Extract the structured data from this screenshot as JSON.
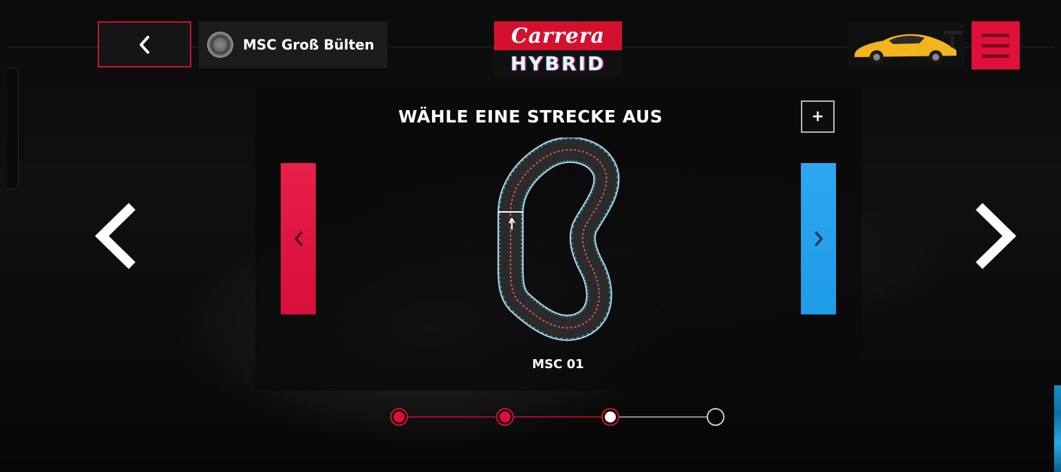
{
  "header": {
    "club_name": "MSC Groß Bülten",
    "logo_top": "Carrera",
    "logo_bottom": "HYBRID"
  },
  "panel": {
    "title": "WÄHLE EINE STRECKE AUS",
    "add_label": "+",
    "track_name": "MSC 01"
  },
  "stepper": {
    "steps": [
      "done",
      "done",
      "current",
      "pending"
    ]
  },
  "colors": {
    "accent_red": "#d3112f",
    "accent_blue": "#1e9be8",
    "menu_red": "#e0103a"
  },
  "icons": {
    "back": "chevron-left-icon",
    "menu": "hamburger-icon",
    "add": "plus-icon",
    "prev": "chevron-left-icon",
    "next": "chevron-right-icon"
  }
}
